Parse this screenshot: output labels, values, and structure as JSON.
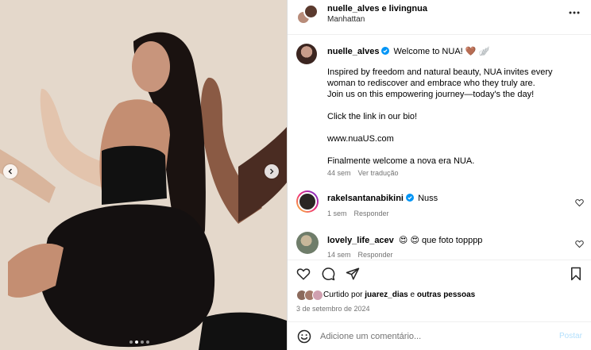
{
  "media": {
    "image_alt": "",
    "slide_count": 4,
    "active_slide": 2,
    "prev_icon": "chevron-left-icon",
    "next_icon": "chevron-right-icon"
  },
  "header": {
    "names": "nuelle_alves e livingnua",
    "location": "Manhattan",
    "more_icon": "more-options-icon"
  },
  "caption": {
    "username": "nuelle_alves",
    "verified": true,
    "headline": "Welcome to NUA! 🤎 🪽",
    "lines": [
      "Inspired by freedom and natural beauty, NUA invites every",
      "woman to rediscover and embrace who they truly are.",
      "Join us on this empowering journey—today's the day!",
      "",
      "Click the link in our bio!",
      "",
      "www.nuaUS.com",
      "",
      "Finalmente welcome a nova era NUA."
    ],
    "time": "44 sem",
    "translate": "Ver tradução"
  },
  "comments": [
    {
      "username": "rakelsantanabikini",
      "verified": true,
      "text": "Nuss",
      "time": "1 sem",
      "reply": "Responder"
    },
    {
      "username": "lovely_life_acev",
      "verified": false,
      "text": "😍 😍  que foto topppp",
      "time": "14 sem",
      "reply": "Responder"
    }
  ],
  "actions": {
    "like_icon": "heart-icon",
    "comment_icon": "comment-bubble-icon",
    "share_icon": "paper-plane-icon",
    "save_icon": "bookmark-icon"
  },
  "likes": {
    "prefix": "Curtido por ",
    "user": "juarez_dias",
    "middle": " e ",
    "others": "outras pessoas"
  },
  "date": "3 de setembro de 2024",
  "add_comment": {
    "placeholder": "Adicione um comentário...",
    "post_label": "Postar",
    "emoji_icon": "emoji-smile-icon"
  },
  "colors": {
    "verified": "#0095f6",
    "muted_text": "#737373",
    "post_disabled": "#b2dffc",
    "border": "#dbdbdb",
    "photo_background": "#e4d8cb"
  }
}
